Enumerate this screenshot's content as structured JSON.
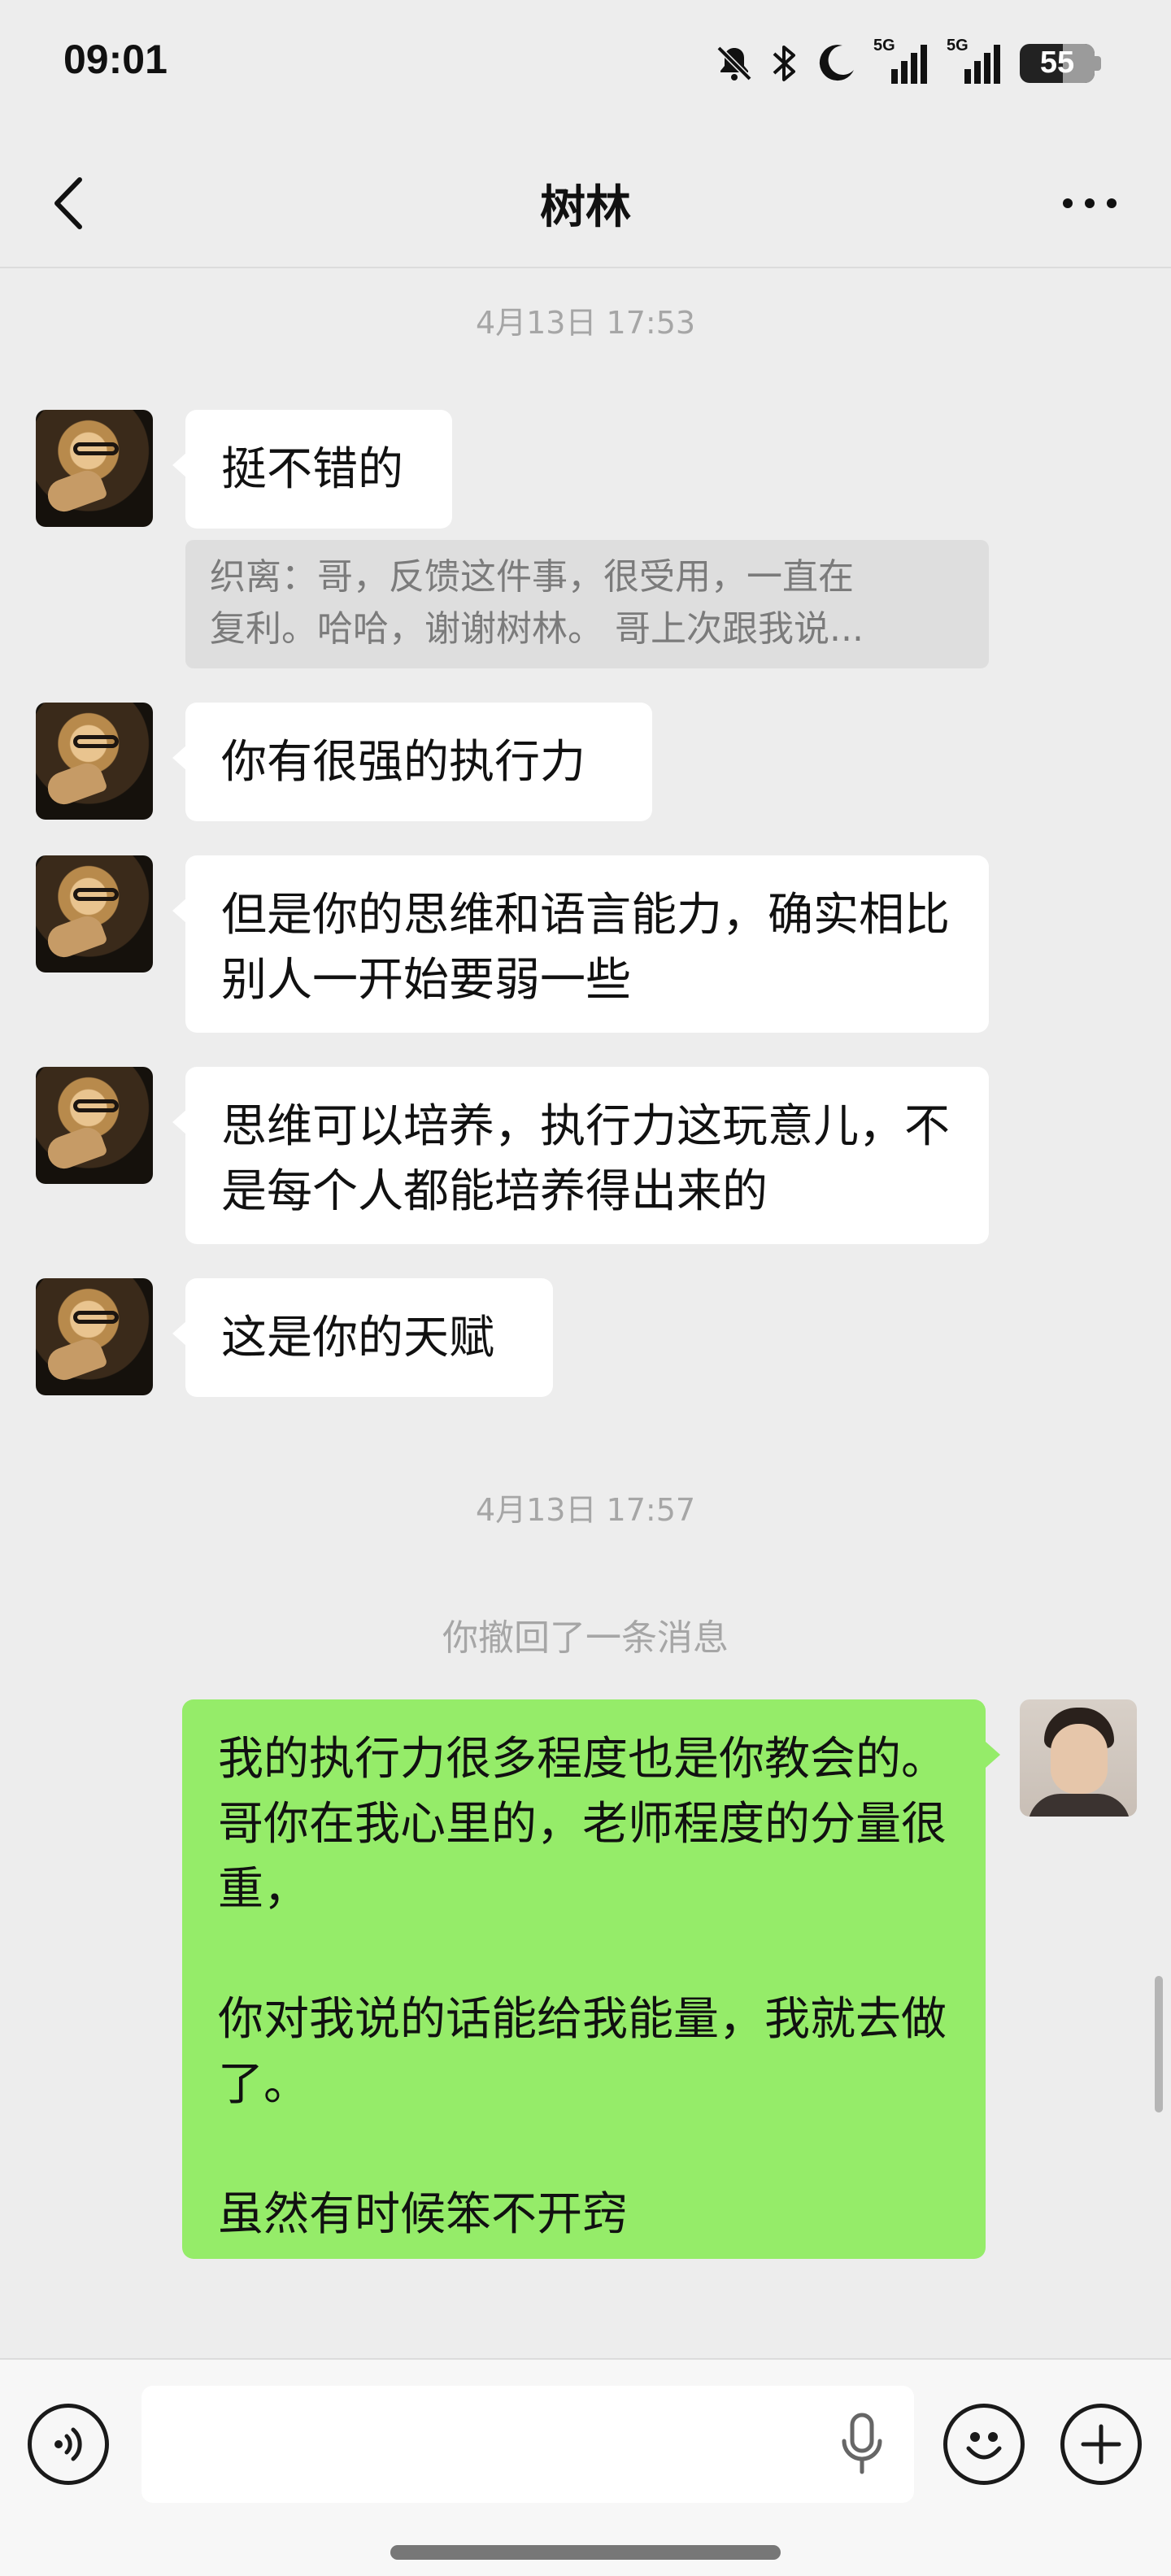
{
  "status_bar": {
    "time": "09:01",
    "network_1": "5G",
    "network_2": "5G",
    "battery_level": "55",
    "icons": [
      "bell-muted-icon",
      "bluetooth-icon",
      "moon-icon",
      "signal-icon",
      "signal-icon",
      "battery-icon"
    ]
  },
  "header": {
    "title": "树林",
    "back_icon": "chevron-left-icon",
    "more_icon": "more-dots-icon"
  },
  "chat": {
    "timestamp_1": "4月13日 17:53",
    "messages_other": [
      {
        "text": "挺不错的"
      },
      {
        "text": "你有很强的执行力"
      },
      {
        "text": "但是你的思维和语言能力，确实相比别人一开始要弱一些"
      },
      {
        "text": "思维可以培养，执行力这玩意儿，不是每个人都能培养得出来的"
      },
      {
        "text": "这是你的天赋"
      }
    ],
    "quote": {
      "line1": "织离：哥，反馈这件事，很受用，一直在",
      "line2": "复利。哈哈，谢谢树林。 哥上次跟我说..."
    },
    "timestamp_2": "4月13日 17:57",
    "recall_notice": "你撤回了一条消息",
    "message_self": "我的执行力很多程度也是你教会的。哥你在我心里的，老师程度的分量很重，\n\n你对我说的话能给我能量，我就去做了。\n\n虽然有时候笨不开窍"
  },
  "input_bar": {
    "voice_icon": "voice-icon",
    "mic_icon": "microphone-icon",
    "emoji_icon": "emoji-icon",
    "plus_icon": "plus-icon",
    "value": ""
  },
  "colors": {
    "background": "#ededed",
    "bubble_self": "#95ec69",
    "bubble_other": "#ffffff"
  }
}
